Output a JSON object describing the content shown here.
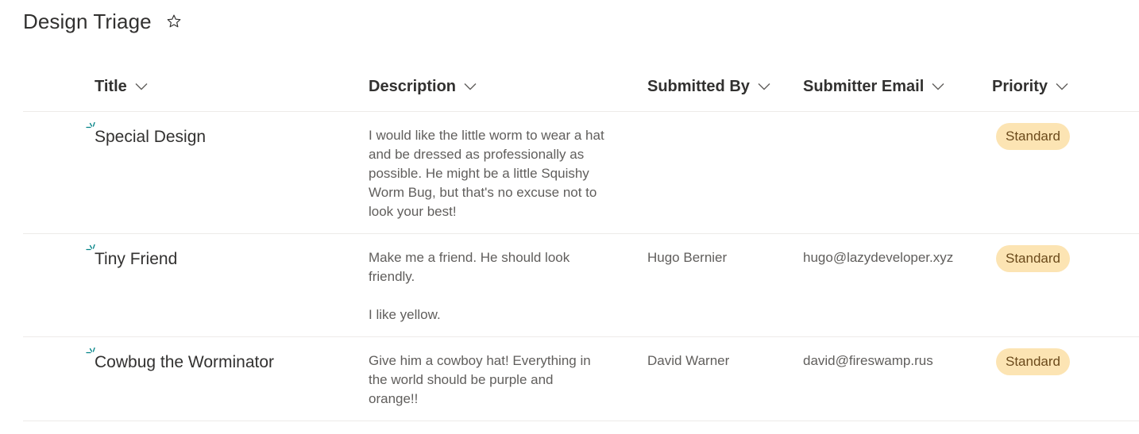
{
  "page": {
    "title": "Design Triage",
    "favorite_icon": "star-outline-icon"
  },
  "columns": [
    {
      "label": "Title"
    },
    {
      "label": "Description"
    },
    {
      "label": "Submitted By"
    },
    {
      "label": "Submitter Email"
    },
    {
      "label": "Priority"
    }
  ],
  "items": [
    {
      "title": "Special Design",
      "description": "I would like the little worm to wear a hat\nand be dressed as professionally as\npossible. He might be a little Squishy\nWorm Bug, but that's no excuse not to\nlook your best!",
      "submitted_by": "",
      "submitter_email": "",
      "priority": "Standard",
      "new_icon": "new-item-sparkle-icon"
    },
    {
      "title": "Tiny Friend",
      "description": "Make me a friend. He should look\nfriendly.\n\nI like yellow.",
      "submitted_by": "Hugo Bernier",
      "submitter_email": "hugo@lazydeveloper.xyz",
      "priority": "Standard",
      "new_icon": "new-item-sparkle-icon"
    },
    {
      "title": "Cowbug the Worminator",
      "description": "Give him a cowboy hat! Everything in\nthe world should be purple and\norange!!",
      "submitted_by": "David Warner",
      "submitter_email": "david@fireswamp.rus",
      "priority": "Standard",
      "new_icon": "new-item-sparkle-icon"
    }
  ],
  "colors": {
    "priority_badge_bg": "#fce4b3",
    "priority_badge_text": "#6b4a1b",
    "new_icon": "#038387"
  }
}
